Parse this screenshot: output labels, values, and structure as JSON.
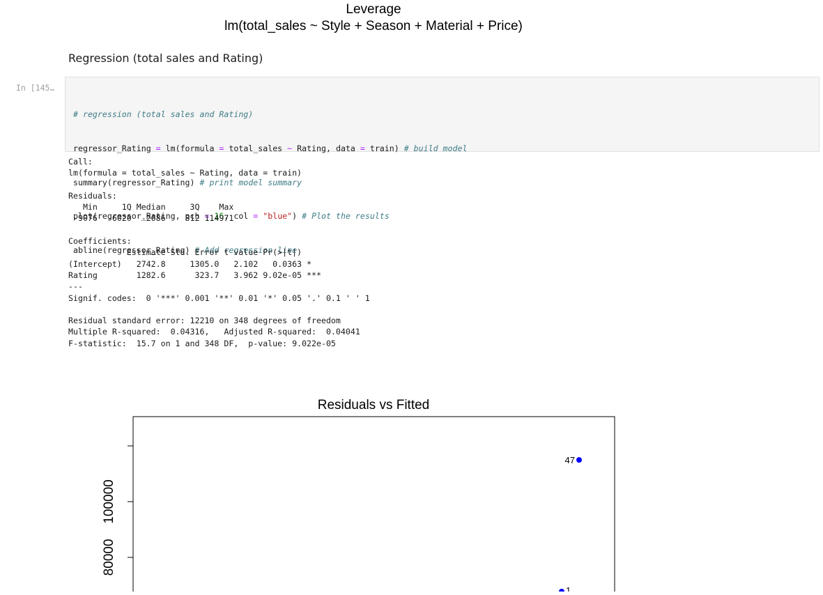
{
  "plot_top": {
    "title_line1": "Leverage",
    "title_line2": "lm(total_sales ~ Style + Season + Material + Price)"
  },
  "notebook": {
    "section_heading": "Regression (total sales and Rating)",
    "prompt": "In [145…",
    "code_lines": [
      "# regression (total sales and Rating)",
      "regressor_Rating = lm(formula = total_sales ~ Rating, data = train) # build model",
      "summary(regressor_Rating) # print model summary",
      "plot(regressor_Rating, pch = 16, col = \"blue\") # Plot the results",
      "abline(regressor_Rating) # Add regression line"
    ],
    "output_lines": [
      "Call:",
      "lm(formula = total_sales ~ Rating, data = train)",
      "",
      "Residuals:",
      "   Min     1Q Median     3Q    Max ",
      " -9076  -6020  -2686    812 114971 ",
      "",
      "Coefficients:",
      "            Estimate Std. Error t value Pr(>|t|)    ",
      "(Intercept)   2742.8     1305.0   2.102   0.0363 *  ",
      "Rating        1282.6      323.7   3.962 9.02e-05 ***",
      "---",
      "Signif. codes:  0 '***' 0.001 '**' 0.01 '*' 0.05 '.' 0.1 ' ' 1",
      "",
      "Residual standard error: 12210 on 348 degrees of freedom",
      "Multiple R-squared:  0.04316,\tAdjusted R-squared:  0.04041 ",
      "F-statistic:  15.7 on 1 and 348 DF,  p-value: 9.022e-05"
    ]
  },
  "colors": {
    "point": "#0000ff",
    "code_background": "#f5f5f5"
  },
  "chart_data": {
    "type": "scatter",
    "title": "Residuals vs Fitted",
    "xlabel": "",
    "ylabel": "",
    "ylim": [
      58000,
      123000
    ],
    "yticks": [
      80000,
      100000
    ],
    "ytick_labels": [
      "80000",
      "100000"
    ],
    "points": [
      {
        "label": "47",
        "y": 114971
      }
    ],
    "partial_points": [
      {
        "label": "1",
        "y": 68000
      }
    ]
  }
}
